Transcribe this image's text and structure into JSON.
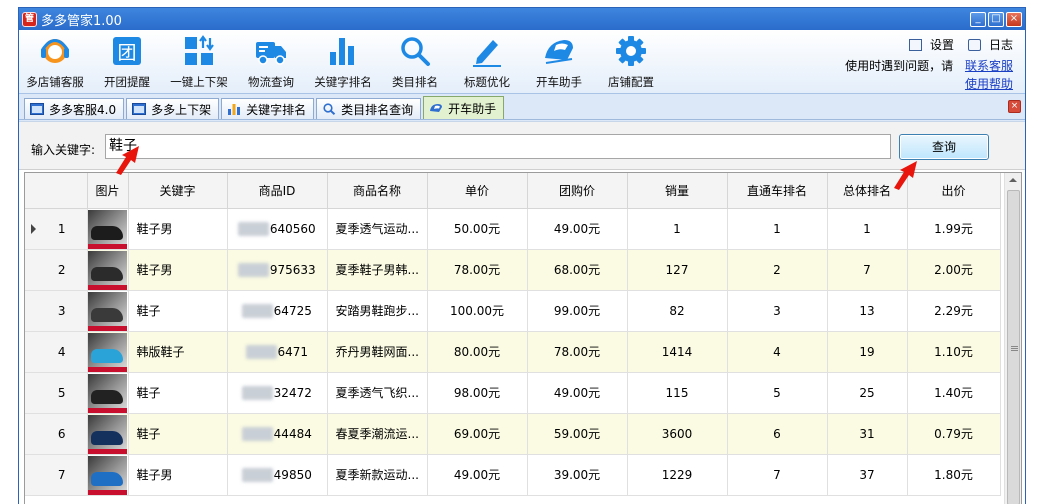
{
  "window": {
    "title": "多多管家1.00",
    "controls": [
      "minimize",
      "maximize",
      "close"
    ]
  },
  "toolbar": {
    "items": [
      {
        "label": "多店铺客服",
        "icon": "headset-icon",
        "color": "#f7941d"
      },
      {
        "label": "开团提醒",
        "icon": "group-buy-icon",
        "color": "#1e88e5"
      },
      {
        "label": "一键上下架",
        "icon": "updown-shelf-icon",
        "color": "#1e88e5"
      },
      {
        "label": "物流查询",
        "icon": "truck-icon",
        "color": "#1e88e5"
      },
      {
        "label": "关键字排名",
        "icon": "bar-chart-icon",
        "color": "#1e88e5"
      },
      {
        "label": "类目排名",
        "icon": "magnifier-icon",
        "color": "#1e88e5"
      },
      {
        "label": "标题优化",
        "icon": "pencil-icon",
        "color": "#1e88e5"
      },
      {
        "label": "开车助手",
        "icon": "train-icon",
        "color": "#1e88e5"
      },
      {
        "label": "店铺配置",
        "icon": "gear-icon",
        "color": "#1e88e5"
      }
    ],
    "settings_label": "设置",
    "log_label": "日志",
    "help_prompt": "使用时遇到问题，请",
    "contact_link": "联系客服",
    "help_link": "使用帮助"
  },
  "tabs": [
    {
      "label": "多多客服4.0",
      "icon": "window-icon",
      "active": false
    },
    {
      "label": "多多上下架",
      "icon": "window-icon",
      "active": false
    },
    {
      "label": "关键字排名",
      "icon": "bar-chart-icon",
      "active": false
    },
    {
      "label": "类目排名查询",
      "icon": "magnifier-icon",
      "active": false
    },
    {
      "label": "开车助手",
      "icon": "train-icon",
      "active": true
    }
  ],
  "search": {
    "label": "输入关键字:",
    "value": "鞋子",
    "button": "查询"
  },
  "table": {
    "columns": [
      "",
      "图片",
      "关键字",
      "商品ID",
      "商品名称",
      "单价",
      "团购价",
      "销量",
      "直通车排名",
      "总体排名",
      "出价"
    ],
    "rows": [
      {
        "num": "1",
        "keyword": "鞋子男",
        "id_hidden": "1000",
        "id_tail": "640560",
        "name": "夏季透气运动...",
        "price": "50.00元",
        "group_price": "49.00元",
        "sales": "1",
        "ztc_rank": "1",
        "total_rank": "1",
        "bid": "1.99元",
        "selected": true
      },
      {
        "num": "2",
        "keyword": "鞋子男",
        "id_hidden": "1000",
        "id_tail": "975633",
        "name": "夏季鞋子男韩...",
        "price": "78.00元",
        "group_price": "68.00元",
        "sales": "127",
        "ztc_rank": "2",
        "total_rank": "7",
        "bid": "2.00元",
        "selected": false
      },
      {
        "num": "3",
        "keyword": "鞋子",
        "id_hidden": "1000",
        "id_tail": "64725",
        "name": "安踏男鞋跑步...",
        "price": "100.00元",
        "group_price": "99.00元",
        "sales": "82",
        "ztc_rank": "3",
        "total_rank": "13",
        "bid": "2.29元",
        "selected": false
      },
      {
        "num": "4",
        "keyword": "韩版鞋子",
        "id_hidden": "1000",
        "id_tail": "6471",
        "name": "乔丹男鞋网面...",
        "price": "80.00元",
        "group_price": "78.00元",
        "sales": "1414",
        "ztc_rank": "4",
        "total_rank": "19",
        "bid": "1.10元",
        "selected": false
      },
      {
        "num": "5",
        "keyword": "鞋子",
        "id_hidden": "1000",
        "id_tail": "32472",
        "name": "夏季透气飞织...",
        "price": "98.00元",
        "group_price": "49.00元",
        "sales": "115",
        "ztc_rank": "5",
        "total_rank": "25",
        "bid": "1.40元",
        "selected": false
      },
      {
        "num": "6",
        "keyword": "鞋子",
        "id_hidden": "1000",
        "id_tail": "44484",
        "name": "春夏季潮流运...",
        "price": "69.00元",
        "group_price": "59.00元",
        "sales": "3600",
        "ztc_rank": "6",
        "total_rank": "31",
        "bid": "0.79元",
        "selected": false
      },
      {
        "num": "7",
        "keyword": "鞋子男",
        "id_hidden": "1000",
        "id_tail": "49850",
        "name": "夏季新款运动...",
        "price": "49.00元",
        "group_price": "39.00元",
        "sales": "1229",
        "ztc_rank": "7",
        "total_rank": "37",
        "bid": "1.80元",
        "selected": false
      }
    ],
    "row_colors": {
      "normal": "#ffffff",
      "alternate": "#fbfbe3"
    },
    "thumb_colors": [
      "#1c1c1c",
      "#2b2b2b",
      "#3a3a3a",
      "#2aa3d8",
      "#222222",
      "#14315e",
      "#1f6fc5"
    ]
  },
  "annotations": {
    "arrow_color": "#e8150c"
  }
}
